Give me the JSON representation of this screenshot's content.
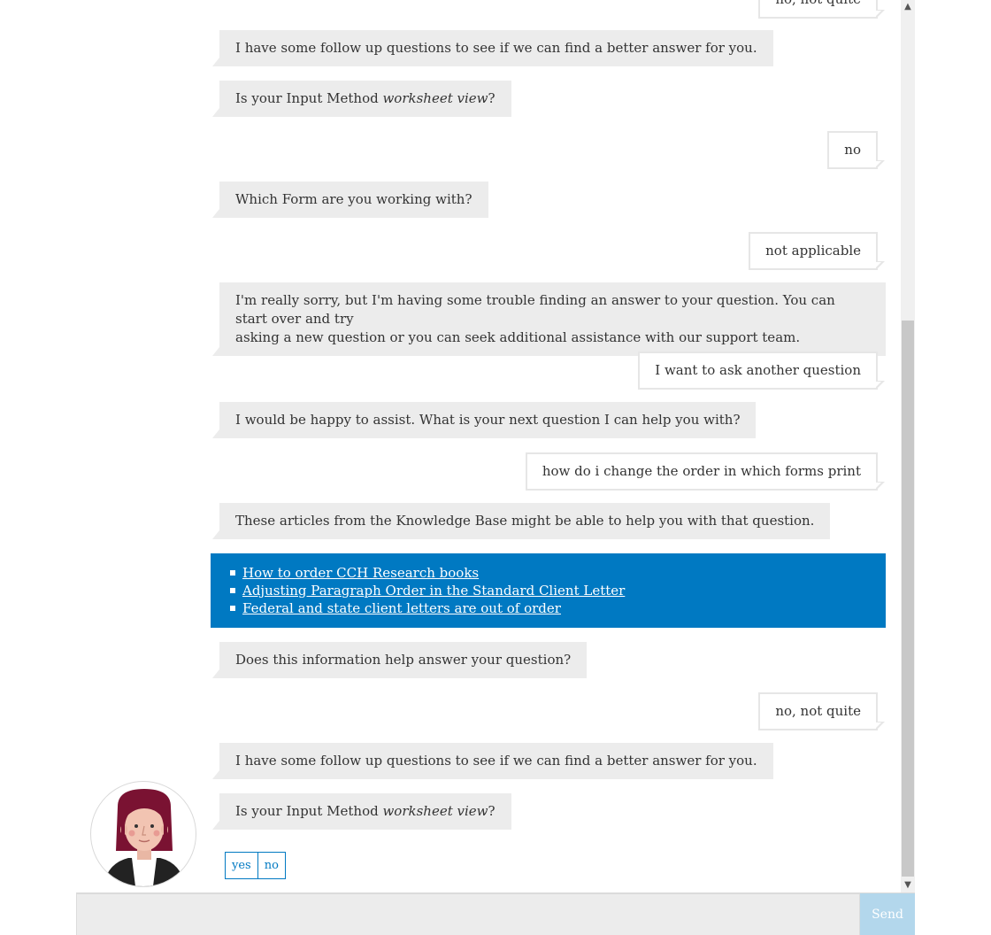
{
  "messages": [
    {
      "from": "user",
      "text": "no, not quite"
    },
    {
      "from": "bot",
      "text": "I have some follow up questions to see if we can find a better answer for you."
    },
    {
      "from": "bot",
      "text_before": "Is your Input Method ",
      "text_italic": "worksheet view",
      "text_after": "?"
    },
    {
      "from": "user",
      "text": "no"
    },
    {
      "from": "bot",
      "text": "Which Form are you working with?"
    },
    {
      "from": "user",
      "text": "not applicable"
    },
    {
      "from": "bot",
      "line1": "I'm really sorry, but I'm having some trouble finding an answer to your question. You can start over and try",
      "line2": "asking a new question or you can seek additional assistance with our support team."
    },
    {
      "from": "user",
      "text": "I want to ask another question"
    },
    {
      "from": "bot",
      "text": "I would be happy to assist. What is your next question I can help you with?"
    },
    {
      "from": "user",
      "text": "how do i change the order in which forms print"
    },
    {
      "from": "bot",
      "text": "These articles from the Knowledge Base might be able to help you with that question."
    },
    {
      "from": "bot",
      "text": "Does this information help answer your question?"
    },
    {
      "from": "user",
      "text": "no, not quite"
    },
    {
      "from": "bot",
      "text": "I have some follow up questions to see if we can find a better answer for you."
    },
    {
      "from": "bot",
      "text_before": "Is your Input Method ",
      "text_italic": "worksheet view",
      "text_after": "?"
    }
  ],
  "kb_articles": [
    {
      "title": "How to order CCH Research books"
    },
    {
      "title": "Adjusting Paragraph Order in the Standard Client Letter"
    },
    {
      "title": "Federal and state client letters are out of order"
    }
  ],
  "quick_replies": {
    "yes": "yes",
    "no": "no"
  },
  "composer": {
    "placeholder": "",
    "send_label": "Send"
  },
  "scrollbar": {
    "up_icon": "▲",
    "down_icon": "▼"
  },
  "colors": {
    "accent": "#0079c2",
    "bot_bubble": "#ececec",
    "send_disabled": "#b3d7ec"
  }
}
